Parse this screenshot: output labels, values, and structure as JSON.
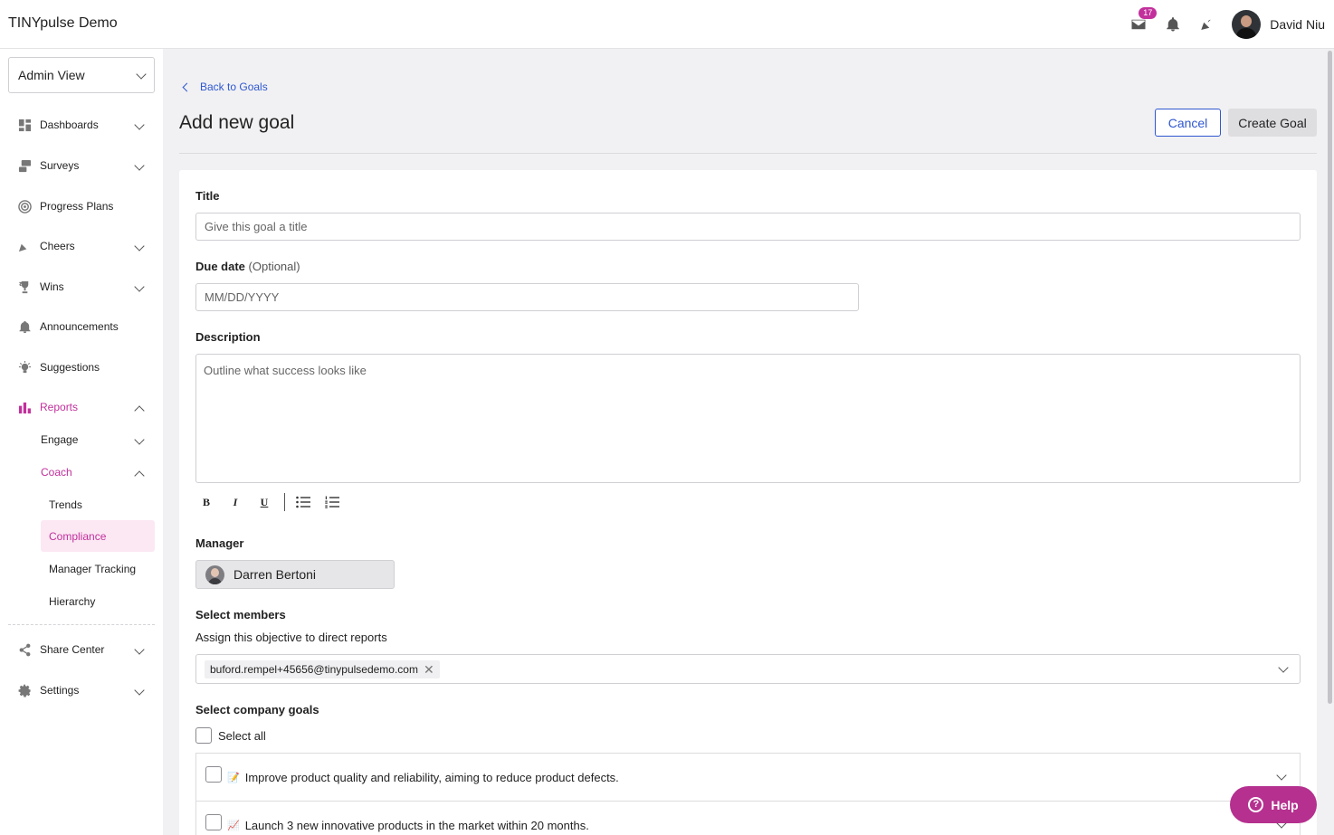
{
  "app": {
    "title": "TINYpulse Demo"
  },
  "topbar": {
    "mail_badge": "17",
    "user_name": "David Niu",
    "icons": [
      "mail-icon",
      "bell-icon",
      "cheers-icon",
      "user-avatar"
    ]
  },
  "sidebar": {
    "view_select": "Admin View",
    "items": [
      {
        "label": "Dashboards",
        "icon": "dashboard-icon"
      },
      {
        "label": "Surveys",
        "icon": "surveys-icon"
      },
      {
        "label": "Progress Plans",
        "icon": "target-icon"
      },
      {
        "label": "Cheers",
        "icon": "megaphone-icon"
      },
      {
        "label": "Wins",
        "icon": "trophy-icon"
      },
      {
        "label": "Announcements",
        "icon": "bell-icon"
      },
      {
        "label": "Suggestions",
        "icon": "lightbulb-icon"
      },
      {
        "label": "Reports",
        "icon": "bar-chart-icon"
      },
      {
        "label": "Share Center",
        "icon": "share-icon"
      },
      {
        "label": "Settings",
        "icon": "gear-icon"
      }
    ],
    "reports_sub": {
      "engage": "Engage",
      "coach": "Coach"
    },
    "coach_sub": [
      "Trends",
      "Compliance",
      "Manager Tracking",
      "Hierarchy"
    ]
  },
  "main": {
    "back_link": "Back to Goals",
    "page_title": "Add new goal",
    "cancel_label": "Cancel",
    "create_label": "Create Goal",
    "form": {
      "title_label": "Title",
      "title_placeholder": "Give this goal a title",
      "due_label": "Due date",
      "due_optional": "(Optional)",
      "due_placeholder": "MM/DD/YYYY",
      "description_label": "Description",
      "description_placeholder": "Outline what success looks like",
      "toolbar": {
        "bold": "B",
        "italic": "I",
        "underline": "U"
      },
      "manager_label": "Manager",
      "manager_name": "Darren Bertoni",
      "members_label": "Select members",
      "members_sublabel": "Assign this objective to direct reports",
      "members_tag": "buford.rempel+45656@tinypulsedemo.com",
      "company_goals_label": "Select company goals",
      "select_all_label": "Select all",
      "goals": [
        {
          "emoji": "📝",
          "text": "Improve product quality and reliability, aiming to reduce product defects."
        },
        {
          "emoji": "📈",
          "text": "Launch 3 new innovative products in the market within 20 months."
        }
      ]
    }
  },
  "help": {
    "label": "Help"
  },
  "colors": {
    "accent": "#c2309c",
    "link": "#2f57cf",
    "help": "#b5308f"
  }
}
